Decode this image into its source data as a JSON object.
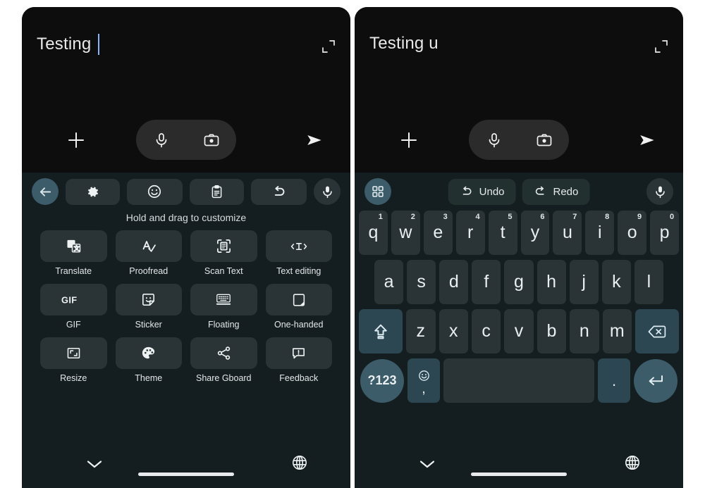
{
  "colors": {
    "page_background": "#ffffff",
    "phone_background": "#0d0d0d",
    "keyboard_background": "#141d1f",
    "key_background": "#2a3436",
    "accent_key_background": "#2c4652",
    "accent_round_background": "#3c5c69",
    "caret": "#8ab4f8",
    "text_primary": "#e9eef0"
  },
  "left_panel": {
    "compose": {
      "text": "Testing ",
      "has_caret": true,
      "expand_icon": "expand-icon",
      "plus_icon": "plus-icon",
      "send_icon": "send-icon",
      "mic_icon": "microphone-icon",
      "camera_icon": "camera-icon"
    },
    "toolbar": {
      "back_icon": "back-arrow-icon",
      "items": [
        {
          "icon": "gear-icon",
          "name": "settings"
        },
        {
          "icon": "emoji-icon",
          "name": "emoji"
        },
        {
          "icon": "clipboard-icon",
          "name": "clipboard"
        },
        {
          "icon": "undo-icon",
          "name": "undo"
        }
      ],
      "mic_icon": "microphone-icon"
    },
    "hint": "Hold and drag to customize",
    "tiles": [
      {
        "label": "Translate",
        "icon": "translate-icon"
      },
      {
        "label": "Proofread",
        "icon": "proofread-icon"
      },
      {
        "label": "Scan Text",
        "icon": "scan-text-icon"
      },
      {
        "label": "Text editing",
        "icon": "text-editing-icon"
      },
      {
        "label": "GIF",
        "icon": "gif-icon"
      },
      {
        "label": "Sticker",
        "icon": "sticker-icon"
      },
      {
        "label": "Floating",
        "icon": "floating-keyboard-icon"
      },
      {
        "label": "One-handed",
        "icon": "one-handed-icon"
      },
      {
        "label": "Resize",
        "icon": "resize-icon"
      },
      {
        "label": "Theme",
        "icon": "palette-icon"
      },
      {
        "label": "Share Gboard",
        "icon": "share-icon"
      },
      {
        "label": "Feedback",
        "icon": "feedback-icon"
      }
    ],
    "navbar": {
      "chevron_icon": "chevron-down-icon",
      "globe_icon": "globe-icon"
    }
  },
  "right_panel": {
    "compose": {
      "text": "Testing u",
      "has_caret": false,
      "expand_icon": "expand-icon",
      "plus_icon": "plus-icon",
      "send_icon": "send-icon",
      "mic_icon": "microphone-icon",
      "camera_icon": "camera-icon"
    },
    "toolbar": {
      "grid_icon": "app-grid-icon",
      "undo_label": "Undo",
      "undo_icon": "undo-icon",
      "redo_label": "Redo",
      "redo_icon": "redo-icon",
      "mic_icon": "microphone-icon"
    },
    "keyboard": {
      "row1": [
        {
          "key": "q",
          "hint": "1"
        },
        {
          "key": "w",
          "hint": "2"
        },
        {
          "key": "e",
          "hint": "3"
        },
        {
          "key": "r",
          "hint": "4"
        },
        {
          "key": "t",
          "hint": "5"
        },
        {
          "key": "y",
          "hint": "6"
        },
        {
          "key": "u",
          "hint": "7"
        },
        {
          "key": "i",
          "hint": "8"
        },
        {
          "key": "o",
          "hint": "9"
        },
        {
          "key": "p",
          "hint": "0"
        }
      ],
      "row2": [
        "a",
        "s",
        "d",
        "f",
        "g",
        "h",
        "j",
        "k",
        "l"
      ],
      "row3": {
        "shift_icon": "shift-icon",
        "letters": [
          "z",
          "x",
          "c",
          "v",
          "b",
          "n",
          "m"
        ],
        "backspace_icon": "backspace-icon"
      },
      "row4": {
        "symbols_label": "?123",
        "emoji_icon": "emoji-icon",
        "comma_label": ",",
        "space_label": "",
        "period_label": ".",
        "enter_icon": "enter-icon"
      }
    },
    "navbar": {
      "chevron_icon": "chevron-down-icon",
      "globe_icon": "globe-icon"
    }
  }
}
